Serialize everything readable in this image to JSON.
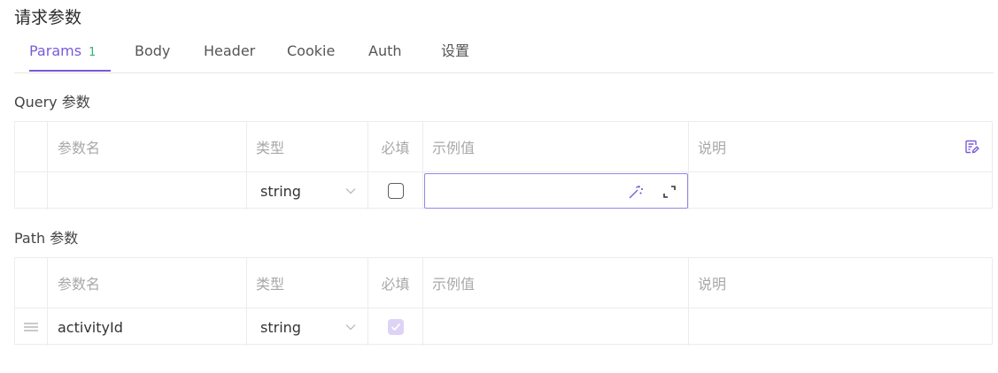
{
  "title": "请求参数",
  "tabs": [
    {
      "label": "Params",
      "count": "1",
      "active": true
    },
    {
      "label": "Body"
    },
    {
      "label": "Header"
    },
    {
      "label": "Cookie"
    },
    {
      "label": "Auth"
    },
    {
      "label": "设置"
    }
  ],
  "columns": {
    "name": "参数名",
    "type": "类型",
    "required": "必填",
    "example": "示例值",
    "description": "说明"
  },
  "query": {
    "title": "Query 参数",
    "rows": [
      {
        "name": "",
        "type": "string",
        "required": false,
        "example": "",
        "description": ""
      }
    ]
  },
  "path": {
    "title": "Path 参数",
    "rows": [
      {
        "name": "activityId",
        "type": "string",
        "required": true,
        "example": "",
        "description": ""
      }
    ]
  },
  "icons": {
    "bulk_edit": "edit-document-icon",
    "magic": "magic-wand-icon",
    "expand": "expand-icon",
    "drag": "drag-handle-icon",
    "dropdown": "chevron-down-icon",
    "check": "check-icon"
  },
  "colors": {
    "accent": "#7a5ad8",
    "count": "#2fb67a",
    "checked_bg": "#dcd3f6"
  }
}
